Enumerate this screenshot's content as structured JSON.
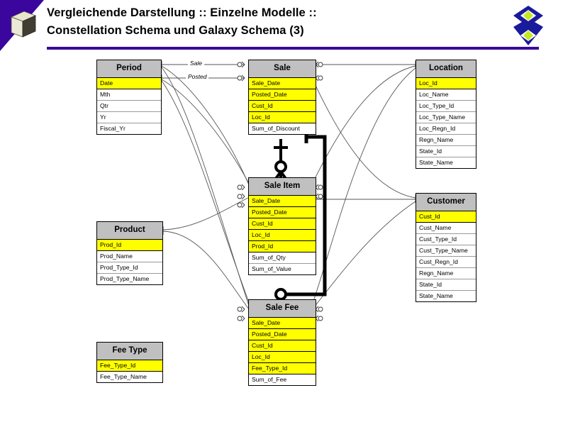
{
  "header": {
    "title_line1": "Vergleichende Darstellung :: Einzelne Modelle ::",
    "title_line2": "Constellation Schema und Galaxy Schema (3)",
    "rule_color": "#3a069e",
    "corner_icon": "cube-icon",
    "brand_icon": "diamond-logo"
  },
  "diagram": {
    "pk_color": "#ffff00",
    "header_color": "#c0c0c0",
    "relationship_labels": [
      {
        "name": "sale",
        "text": "Sale"
      },
      {
        "name": "posted",
        "text": "Posted"
      }
    ],
    "entities": [
      {
        "id": "period",
        "title": "Period",
        "attributes": [
          {
            "name": "Date",
            "pk": true
          },
          {
            "name": "Mth",
            "pk": false
          },
          {
            "name": "Qtr",
            "pk": false
          },
          {
            "name": "Yr",
            "pk": false
          },
          {
            "name": "Fiscal_Yr",
            "pk": false
          }
        ]
      },
      {
        "id": "sale",
        "title": "Sale",
        "attributes": [
          {
            "name": "Sale_Date",
            "pk": true
          },
          {
            "name": "Posted_Date",
            "pk": true
          },
          {
            "name": "Cust_Id",
            "pk": true
          },
          {
            "name": "Loc_Id",
            "pk": true
          },
          {
            "name": "Sum_of_Discount",
            "pk": false
          }
        ]
      },
      {
        "id": "location",
        "title": "Location",
        "attributes": [
          {
            "name": "Loc_Id",
            "pk": true
          },
          {
            "name": "Loc_Name",
            "pk": false
          },
          {
            "name": "Loc_Type_Id",
            "pk": false
          },
          {
            "name": "Loc_Type_Name",
            "pk": false
          },
          {
            "name": "Loc_Regn_Id",
            "pk": false
          },
          {
            "name": "Regn_Name",
            "pk": false
          },
          {
            "name": "State_Id",
            "pk": false
          },
          {
            "name": "State_Name",
            "pk": false
          }
        ]
      },
      {
        "id": "saleitem",
        "title": "Sale Item",
        "attributes": [
          {
            "name": "Sale_Date",
            "pk": true
          },
          {
            "name": "Posted_Date",
            "pk": true
          },
          {
            "name": "Cust_Id",
            "pk": true
          },
          {
            "name": "Loc_Id",
            "pk": true
          },
          {
            "name": "Prod_Id",
            "pk": true
          },
          {
            "name": "Sum_of_Qty",
            "pk": false
          },
          {
            "name": "Sum_of_Value",
            "pk": false
          }
        ]
      },
      {
        "id": "product",
        "title": "Product",
        "attributes": [
          {
            "name": "Prod_Id",
            "pk": true
          },
          {
            "name": "Prod_Name",
            "pk": false
          },
          {
            "name": "Prod_Type_Id",
            "pk": false
          },
          {
            "name": "Prod_Type_Name",
            "pk": false
          }
        ]
      },
      {
        "id": "customer",
        "title": "Customer",
        "attributes": [
          {
            "name": "Cust_Id",
            "pk": true
          },
          {
            "name": "Cust_Name",
            "pk": false
          },
          {
            "name": "Cust_Type_Id",
            "pk": false
          },
          {
            "name": "Cust_Type_Name",
            "pk": false
          },
          {
            "name": "Cust_Regn_Id",
            "pk": false
          },
          {
            "name": "Regn_Name",
            "pk": false
          },
          {
            "name": "State_Id",
            "pk": false
          },
          {
            "name": "State_Name",
            "pk": false
          }
        ]
      },
      {
        "id": "salefee",
        "title": "Sale Fee",
        "attributes": [
          {
            "name": "Sale_Date",
            "pk": true
          },
          {
            "name": "Posted_Date",
            "pk": true
          },
          {
            "name": "Cust_Id",
            "pk": true
          },
          {
            "name": "Loc_Id",
            "pk": true
          },
          {
            "name": "Fee_Type_Id",
            "pk": true
          },
          {
            "name": "Sum_of_Fee",
            "pk": false
          }
        ]
      },
      {
        "id": "feetype",
        "title": "Fee Type",
        "attributes": [
          {
            "name": "Fee_Type_Id",
            "pk": true
          },
          {
            "name": "Fee_Type_Name",
            "pk": false
          }
        ]
      }
    ]
  }
}
